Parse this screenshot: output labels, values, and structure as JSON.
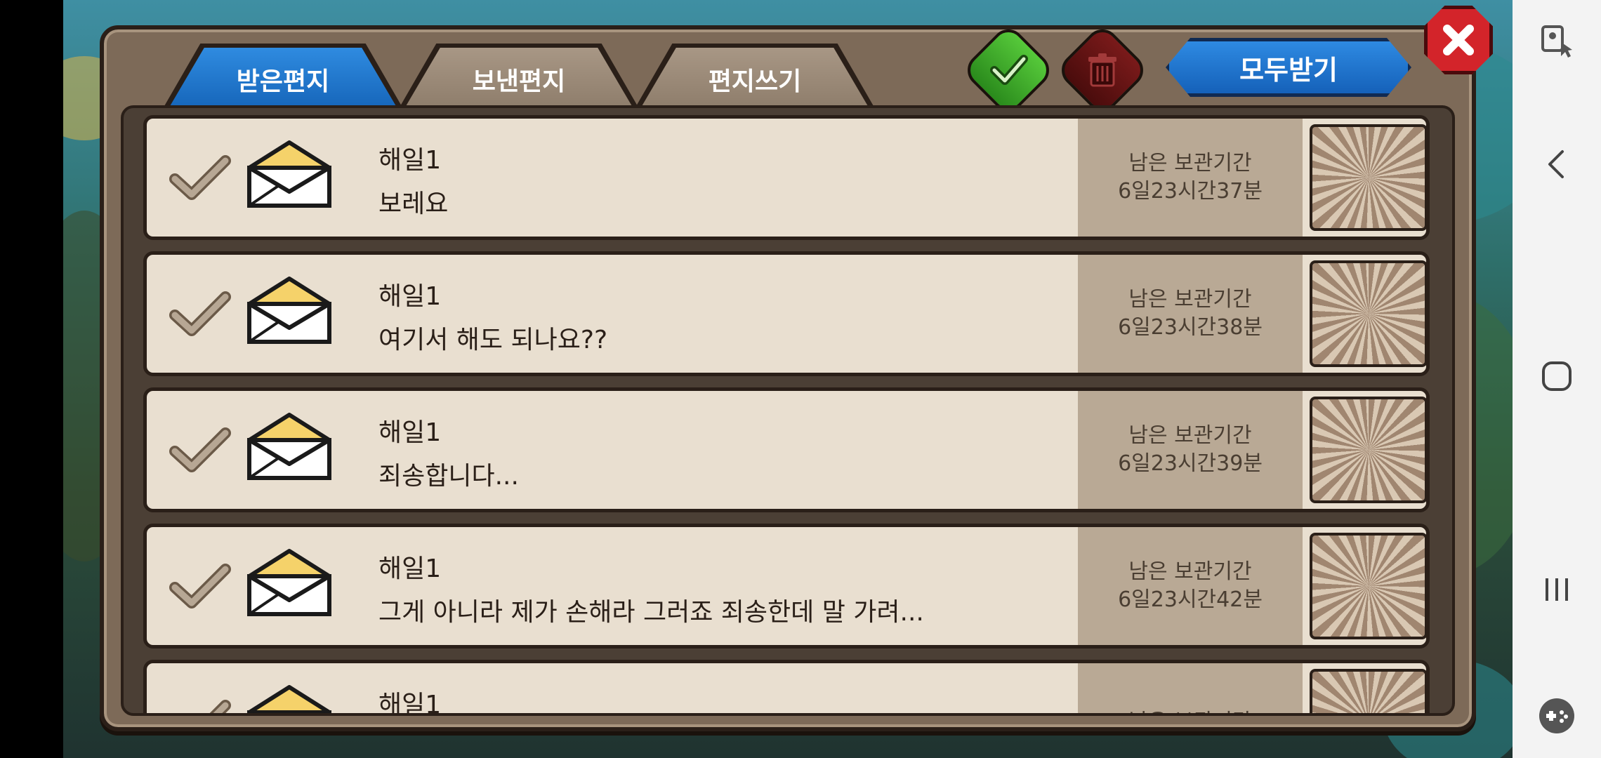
{
  "tabs": [
    {
      "label": "받은편지",
      "active": true
    },
    {
      "label": "보낸편지",
      "active": false
    },
    {
      "label": "편지쓰기",
      "active": false
    }
  ],
  "toolbar": {
    "select_all_icon": "green-check-icon",
    "delete_icon": "trash-icon",
    "receive_all_label": "모두받기",
    "close_icon": "close-x-icon"
  },
  "mails": [
    {
      "sender": "해일1",
      "subject": "보레요",
      "expire_label": "남은 보관기간",
      "expire_value": "6일23시간37분"
    },
    {
      "sender": "해일1",
      "subject": "여기서 해도 되나요??",
      "expire_label": "남은 보관기간",
      "expire_value": "6일23시간38분"
    },
    {
      "sender": "해일1",
      "subject": "죄송합니다...",
      "expire_label": "남은 보관기간",
      "expire_value": "6일23시간39분"
    },
    {
      "sender": "해일1",
      "subject": "그게 아니라 제가 손해라 그러죠 죄송한데 말 가려...",
      "expire_label": "남은 보관기간",
      "expire_value": "6일23시간42분"
    },
    {
      "sender": "해일1",
      "subject": "",
      "expire_label": "남은 보관기간",
      "expire_value": ""
    }
  ],
  "navbar": {
    "items": [
      "screen-pin-icon",
      "back-icon",
      "home-icon",
      "recents-icon",
      "game-tools-icon"
    ]
  },
  "colors": {
    "tab_active": "#1f78d1",
    "receive_all": "#2a7fd8",
    "check_green": "#3fae2a",
    "trash_red": "#6a1414",
    "close_red": "#d3242a"
  }
}
